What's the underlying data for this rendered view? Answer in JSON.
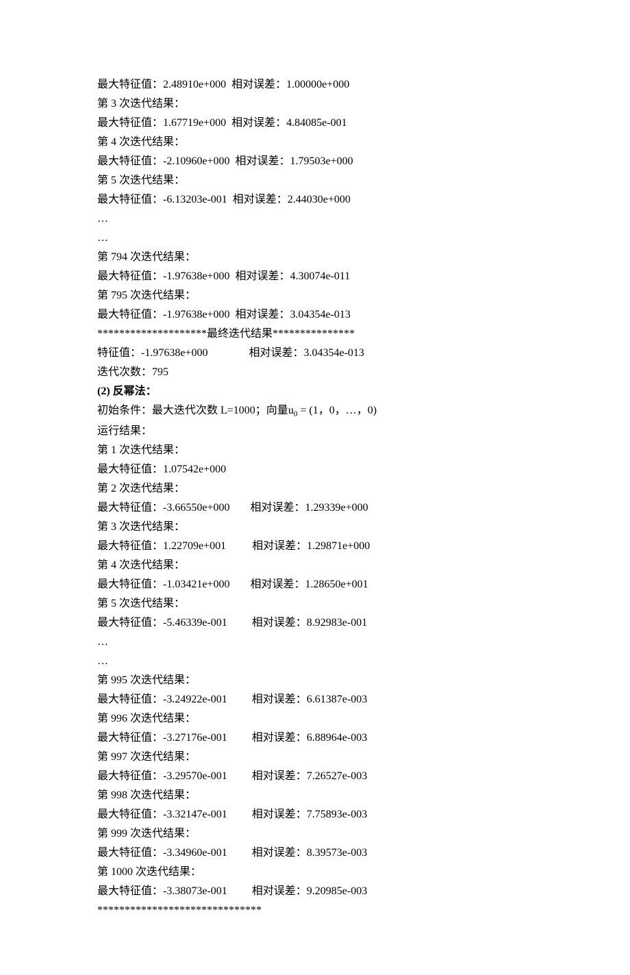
{
  "lines": [
    {
      "type": "pair",
      "left": "最大特征值：2.48910e+000",
      "right": "相对误差：1.00000e+000",
      "gap": 8
    },
    {
      "type": "text",
      "text": "第 3 次迭代结果："
    },
    {
      "type": "pair",
      "left": "最大特征值：1.67719e+000",
      "right": "相对误差：4.84085e-001",
      "gap": 8
    },
    {
      "type": "text",
      "text": "第 4 次迭代结果："
    },
    {
      "type": "pair",
      "left": "最大特征值：-2.10960e+000",
      "right": "相对误差：1.79503e+000",
      "gap": 8
    },
    {
      "type": "text",
      "text": "第 5 次迭代结果："
    },
    {
      "type": "pair",
      "left": "最大特征值：-6.13203e-001",
      "right": "相对误差：2.44030e+000",
      "gap": 8
    },
    {
      "type": "text",
      "text": "…"
    },
    {
      "type": "text",
      "text": "…"
    },
    {
      "type": "text",
      "text": "第 794 次迭代结果："
    },
    {
      "type": "pair",
      "left": "最大特征值：-1.97638e+000",
      "right": "相对误差：4.30074e-011",
      "gap": 8
    },
    {
      "type": "text",
      "text": "第 795 次迭代结果："
    },
    {
      "type": "pair",
      "left": "最大特征值：-1.97638e+000",
      "right": "相对误差：3.04354e-013",
      "gap": 8
    },
    {
      "type": "text",
      "text": "********************最终迭代结果***************"
    },
    {
      "type": "pair",
      "left": "特征值：-1.97638e+000",
      "right": "相对误差：3.04354e-013",
      "gap": 60
    },
    {
      "type": "text",
      "text": "迭代次数：795"
    },
    {
      "type": "bold",
      "text": "(2)   反幂法："
    },
    {
      "type": "init",
      "prefix": "初始条件：最大迭代次数 L=1000；向量",
      "var": "u",
      "sub": "0",
      "suffix": " = (1，0，…，0)"
    },
    {
      "type": "text",
      "text": "运行结果："
    },
    {
      "type": "text",
      "text": "第 1 次迭代结果："
    },
    {
      "type": "text",
      "text": "最大特征值：1.07542e+000"
    },
    {
      "type": "text",
      "text": "第 2 次迭代结果："
    },
    {
      "type": "pair",
      "left": "最大特征值：-3.66550e+000",
      "right": "相对误差：1.29339e+000",
      "gap": 30
    },
    {
      "type": "text",
      "text": "第 3 次迭代结果："
    },
    {
      "type": "pair",
      "left": "最大特征值：1.22709e+001",
      "right": "相对误差：1.29871e+000",
      "gap": 38
    },
    {
      "type": "text",
      "text": "第 4 次迭代结果："
    },
    {
      "type": "pair",
      "left": "最大特征值：-1.03421e+000",
      "right": "相对误差：1.28650e+001",
      "gap": 30
    },
    {
      "type": "text",
      "text": "第 5 次迭代结果："
    },
    {
      "type": "pair",
      "left": "最大特征值：-5.46339e-001",
      "right": "相对误差：8.92983e-001",
      "gap": 36
    },
    {
      "type": "text",
      "text": "…"
    },
    {
      "type": "text",
      "text": "…"
    },
    {
      "type": "text",
      "text": "第 995 次迭代结果："
    },
    {
      "type": "pair",
      "left": "最大特征值：-3.24922e-001",
      "right": "相对误差：6.61387e-003",
      "gap": 36
    },
    {
      "type": "text",
      "text": "第 996 次迭代结果："
    },
    {
      "type": "pair",
      "left": "最大特征值：-3.27176e-001",
      "right": "相对误差：6.88964e-003",
      "gap": 36
    },
    {
      "type": "text",
      "text": "第 997 次迭代结果："
    },
    {
      "type": "pair",
      "left": "最大特征值：-3.29570e-001",
      "right": "相对误差：7.26527e-003",
      "gap": 36
    },
    {
      "type": "text",
      "text": "第 998 次迭代结果："
    },
    {
      "type": "pair",
      "left": "最大特征值：-3.32147e-001",
      "right": "相对误差：7.75893e-003",
      "gap": 36
    },
    {
      "type": "text",
      "text": "第 999 次迭代结果："
    },
    {
      "type": "pair",
      "left": "最大特征值：-3.34960e-001",
      "right": "相对误差：8.39573e-003",
      "gap": 36
    },
    {
      "type": "text",
      "text": "第 1000 次迭代结果："
    },
    {
      "type": "pair",
      "left": "最大特征值：-3.38073e-001",
      "right": "相对误差：9.20985e-003",
      "gap": 36
    },
    {
      "type": "text",
      "text": "******************************"
    }
  ]
}
